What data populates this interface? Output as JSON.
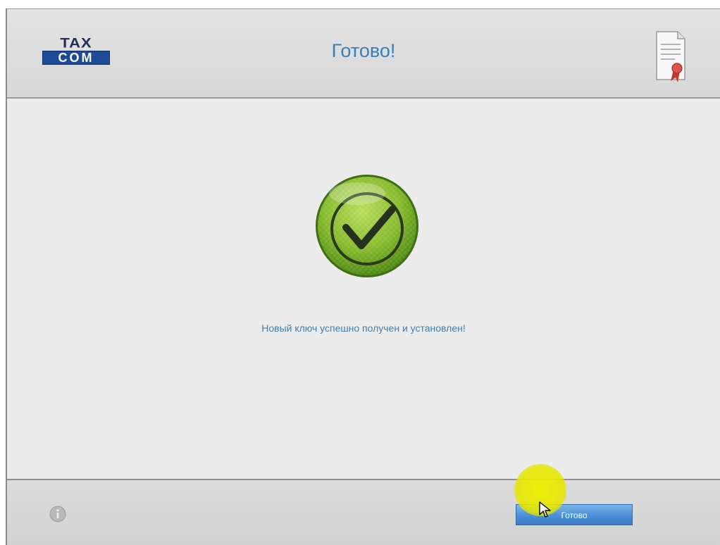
{
  "header": {
    "logo_top": "TAX",
    "logo_bottom": "COM",
    "title": "Готово!",
    "certificate_icon": "certificate-icon"
  },
  "content": {
    "status_icon": "checkmark-icon",
    "message": "Новый ключ успешно получен и установлен!"
  },
  "footer": {
    "info_icon": "info-icon",
    "done_label": "Готово"
  },
  "colors": {
    "title": "#3a7fb5",
    "message": "#3f7fb0",
    "button": "#4b8fd6",
    "check_green": "#7bb02a"
  }
}
